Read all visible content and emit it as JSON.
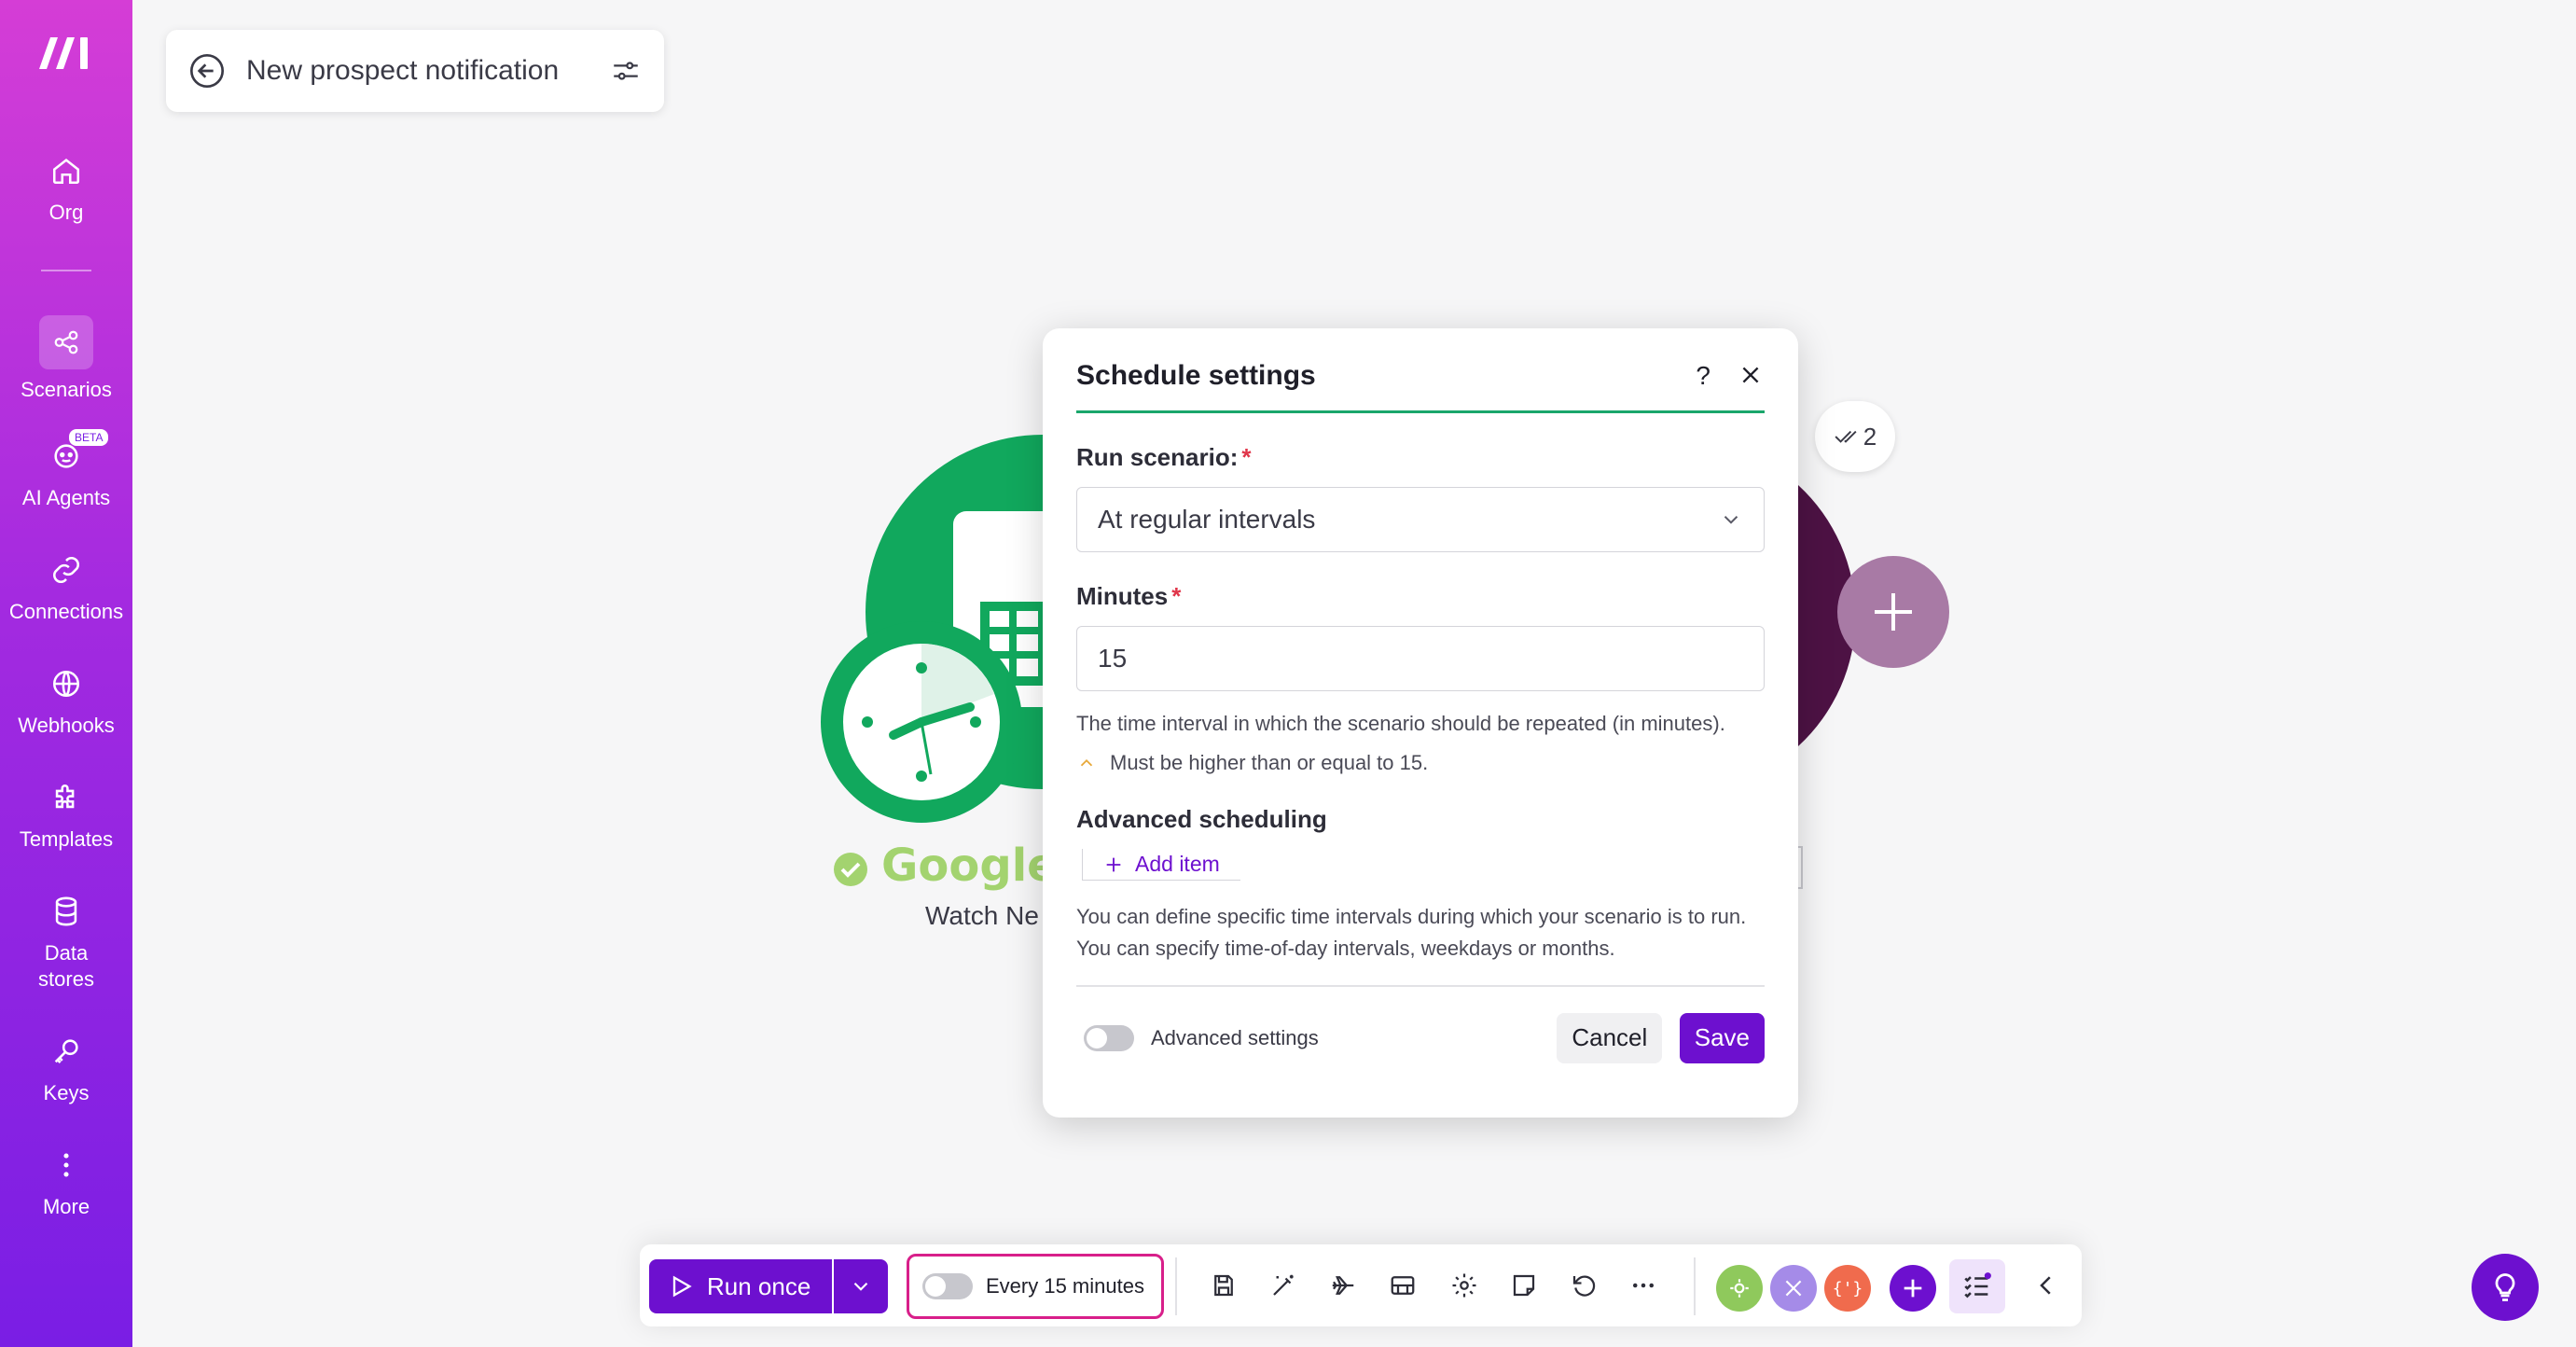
{
  "sidebar": {
    "items": [
      {
        "label": "Org",
        "icon": "home-icon"
      },
      {
        "label": "Scenarios",
        "icon": "share-nodes-icon"
      },
      {
        "label": "AI Agents",
        "icon": "ai-agent-icon",
        "badge": "BETA"
      },
      {
        "label": "Connections",
        "icon": "link-icon"
      },
      {
        "label": "Webhooks",
        "icon": "globe-icon"
      },
      {
        "label": "Templates",
        "icon": "puzzle-icon"
      },
      {
        "label": "Data stores",
        "icon": "database-icon"
      },
      {
        "label": "Keys",
        "icon": "key-icon"
      },
      {
        "label": "More",
        "icon": "more-vertical-icon"
      }
    ],
    "active": "Scenarios"
  },
  "header": {
    "scenario_name": "New prospect notification"
  },
  "canvas": {
    "module_title": "Google S",
    "module_subtitle": "Watch Ne",
    "operations_badge": "2"
  },
  "modal": {
    "title": "Schedule settings",
    "help": "?",
    "run_label": "Run scenario:",
    "run_value": "At regular intervals",
    "minutes_label": "Minutes",
    "minutes_value": "15",
    "minutes_help": "The time interval in which the scenario should be repeated (in minutes).",
    "minutes_warning": "Must be higher than or equal to 15.",
    "advanced_title": "Advanced scheduling",
    "add_item": "Add item",
    "advanced_help": "You can define specific time intervals during which your scenario is to run. You can specify time-of-day intervals, weekdays or months.",
    "advanced_settings_label": "Advanced settings",
    "cancel": "Cancel",
    "save": "Save"
  },
  "toolbar": {
    "run_once": "Run once",
    "schedule_label": "Every 15 minutes"
  },
  "colors": {
    "brand": "#6d10cf",
    "accent_green": "#1aa66b",
    "highlight": "#d81f8a"
  }
}
